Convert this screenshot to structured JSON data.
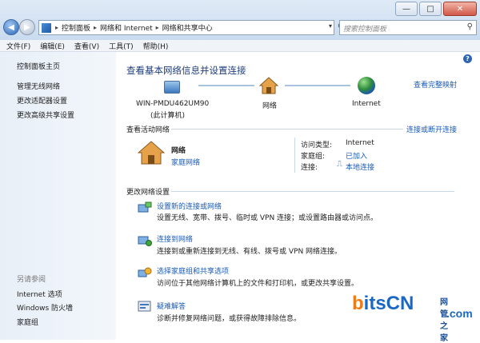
{
  "window": {
    "controls": {
      "minimize": "—",
      "maximize": "□",
      "close": "✕"
    }
  },
  "address": {
    "crumbs": [
      "控制面板",
      "网络和 Internet",
      "网络和共享中心"
    ],
    "separator": "▸"
  },
  "search": {
    "placeholder": "搜索控制面板"
  },
  "menu": [
    "文件(F)",
    "编辑(E)",
    "查看(V)",
    "工具(T)",
    "帮助(H)"
  ],
  "sidebar": {
    "items": [
      "控制面板主页",
      "管理无线网络",
      "更改适配器设置",
      "更改高级共享设置"
    ],
    "see_also_title": "另请参阅",
    "see_also": [
      "Internet 选项",
      "Windows 防火墙",
      "家庭组"
    ]
  },
  "main": {
    "title": "查看基本网络信息并设置连接",
    "full_map_link": "查看完整映射",
    "map": {
      "computer_name": "WIN-PMDU462UM90",
      "computer_sub": "(此计算机)",
      "network": "网络",
      "internet": "Internet"
    },
    "active_title": "查看活动网络",
    "connect_disconnect_link": "连接或断开连接",
    "active": {
      "name": "网络",
      "type": "家庭网络",
      "access_type_label": "访问类型:",
      "access_type_value": "Internet",
      "homegroup_label": "家庭组:",
      "homegroup_value": "已加入",
      "connections_label": "连接:",
      "connections_value": "本地连接"
    },
    "change_title": "更改网络设置",
    "tasks": [
      {
        "title": "设置新的连接或网络",
        "desc": "设置无线、宽带、拨号、临时或 VPN 连接；或设置路由器或访问点。"
      },
      {
        "title": "连接到网络",
        "desc": "连接到或重新连接到无线、有线、拨号或 VPN 网络连接。"
      },
      {
        "title": "选择家庭组和共享选项",
        "desc": "访问位于其他网络计算机上的文件和打印机，或更改共享设置。"
      },
      {
        "title": "疑难解答",
        "desc": "诊断并修复网络问题，或获得故障排除信息。"
      }
    ]
  },
  "watermark": {
    "b": "b",
    "text": "itsCN",
    "sub": "网管之家",
    "com": ".com"
  },
  "colors": {
    "link": "#1a5bb8",
    "title": "#1e3d7b",
    "accent": "#f07a14"
  }
}
